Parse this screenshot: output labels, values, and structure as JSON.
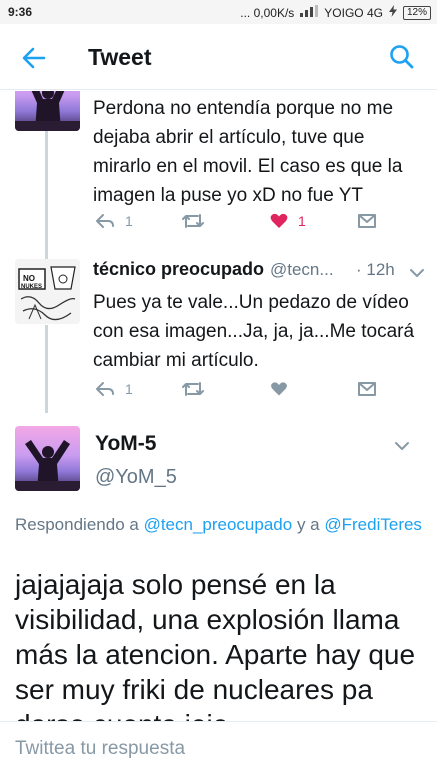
{
  "status_bar": {
    "time": "9:36",
    "network_speed": "... 0,00K/s",
    "carrier": "YOIGO 4G",
    "battery": "12%"
  },
  "header": {
    "title": "Tweet",
    "back_icon": "arrow-left-icon",
    "search_icon": "search-icon"
  },
  "tweets": [
    {
      "text": "Perdona no entendía porque no me dejaba abrir el artículo, tuve que mirarlo en el movil. El caso es que la imagen la puse yo xD no fue YT",
      "reply_count": "1",
      "retweet_count": "",
      "like_count": "1",
      "liked": true
    },
    {
      "name": "técnico preocupado",
      "handle": "@tecn...",
      "time": "· 12h",
      "text": "Pues ya te vale...Un pedazo de vídeo con esa imagen...Ja, ja, ja...Me tocará cambiar mi artículo.",
      "reply_count": "1",
      "retweet_count": "",
      "like_count": ""
    }
  ],
  "main_tweet": {
    "name": "YoM-5",
    "handle": "@YoM_5",
    "replying_prefix": "Respondiendo a",
    "replying_to_1": "@tecn_preocupado",
    "replying_join": "y a",
    "replying_to_2": "@FrediTeres",
    "text": "jajajajaja solo pensé en la visibilidad, una explosión llama más la atencion. Aparte hay que ser muy friki de nucleares pa darse cuenta jeje"
  },
  "composer": {
    "placeholder": "Twittea tu respuesta"
  },
  "colors": {
    "accent": "#1da1f2",
    "like": "#e0245e",
    "muted": "#8899a6"
  }
}
